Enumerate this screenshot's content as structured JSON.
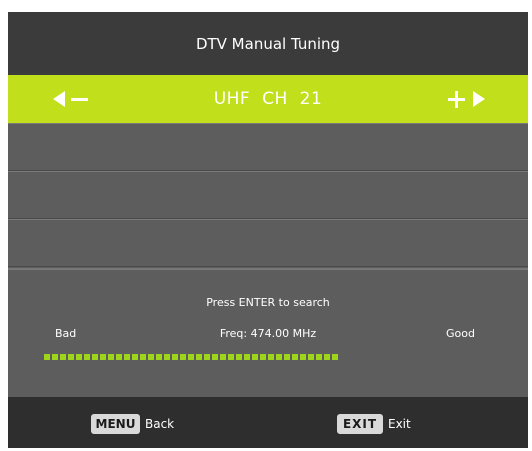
{
  "title": "DTV Manual Tuning",
  "channel": {
    "band": "UHF",
    "ch_label": "CH",
    "number": "21",
    "text": "UHF  CH  21"
  },
  "empty_rows": [
    "",
    "",
    ""
  ],
  "search_prompt": "Press ENTER to search",
  "signal": {
    "bad_label": "Bad",
    "good_label": "Good",
    "freq_text": "Freq: 474.00 MHz",
    "segments": 37
  },
  "footer": {
    "menu_key": "MENU",
    "menu_label": "Back",
    "exit_key": "EXIT",
    "exit_label": "Exit"
  },
  "colors": {
    "accent": "#c1df1a",
    "meter": "#9ed41a",
    "title_bg": "#3b3b3b",
    "panel_bg": "#5d5d5d",
    "footer_bg": "#2e2e2e"
  },
  "icons": [
    "left-triangle-icon",
    "minus-icon",
    "plus-icon",
    "right-triangle-icon"
  ]
}
